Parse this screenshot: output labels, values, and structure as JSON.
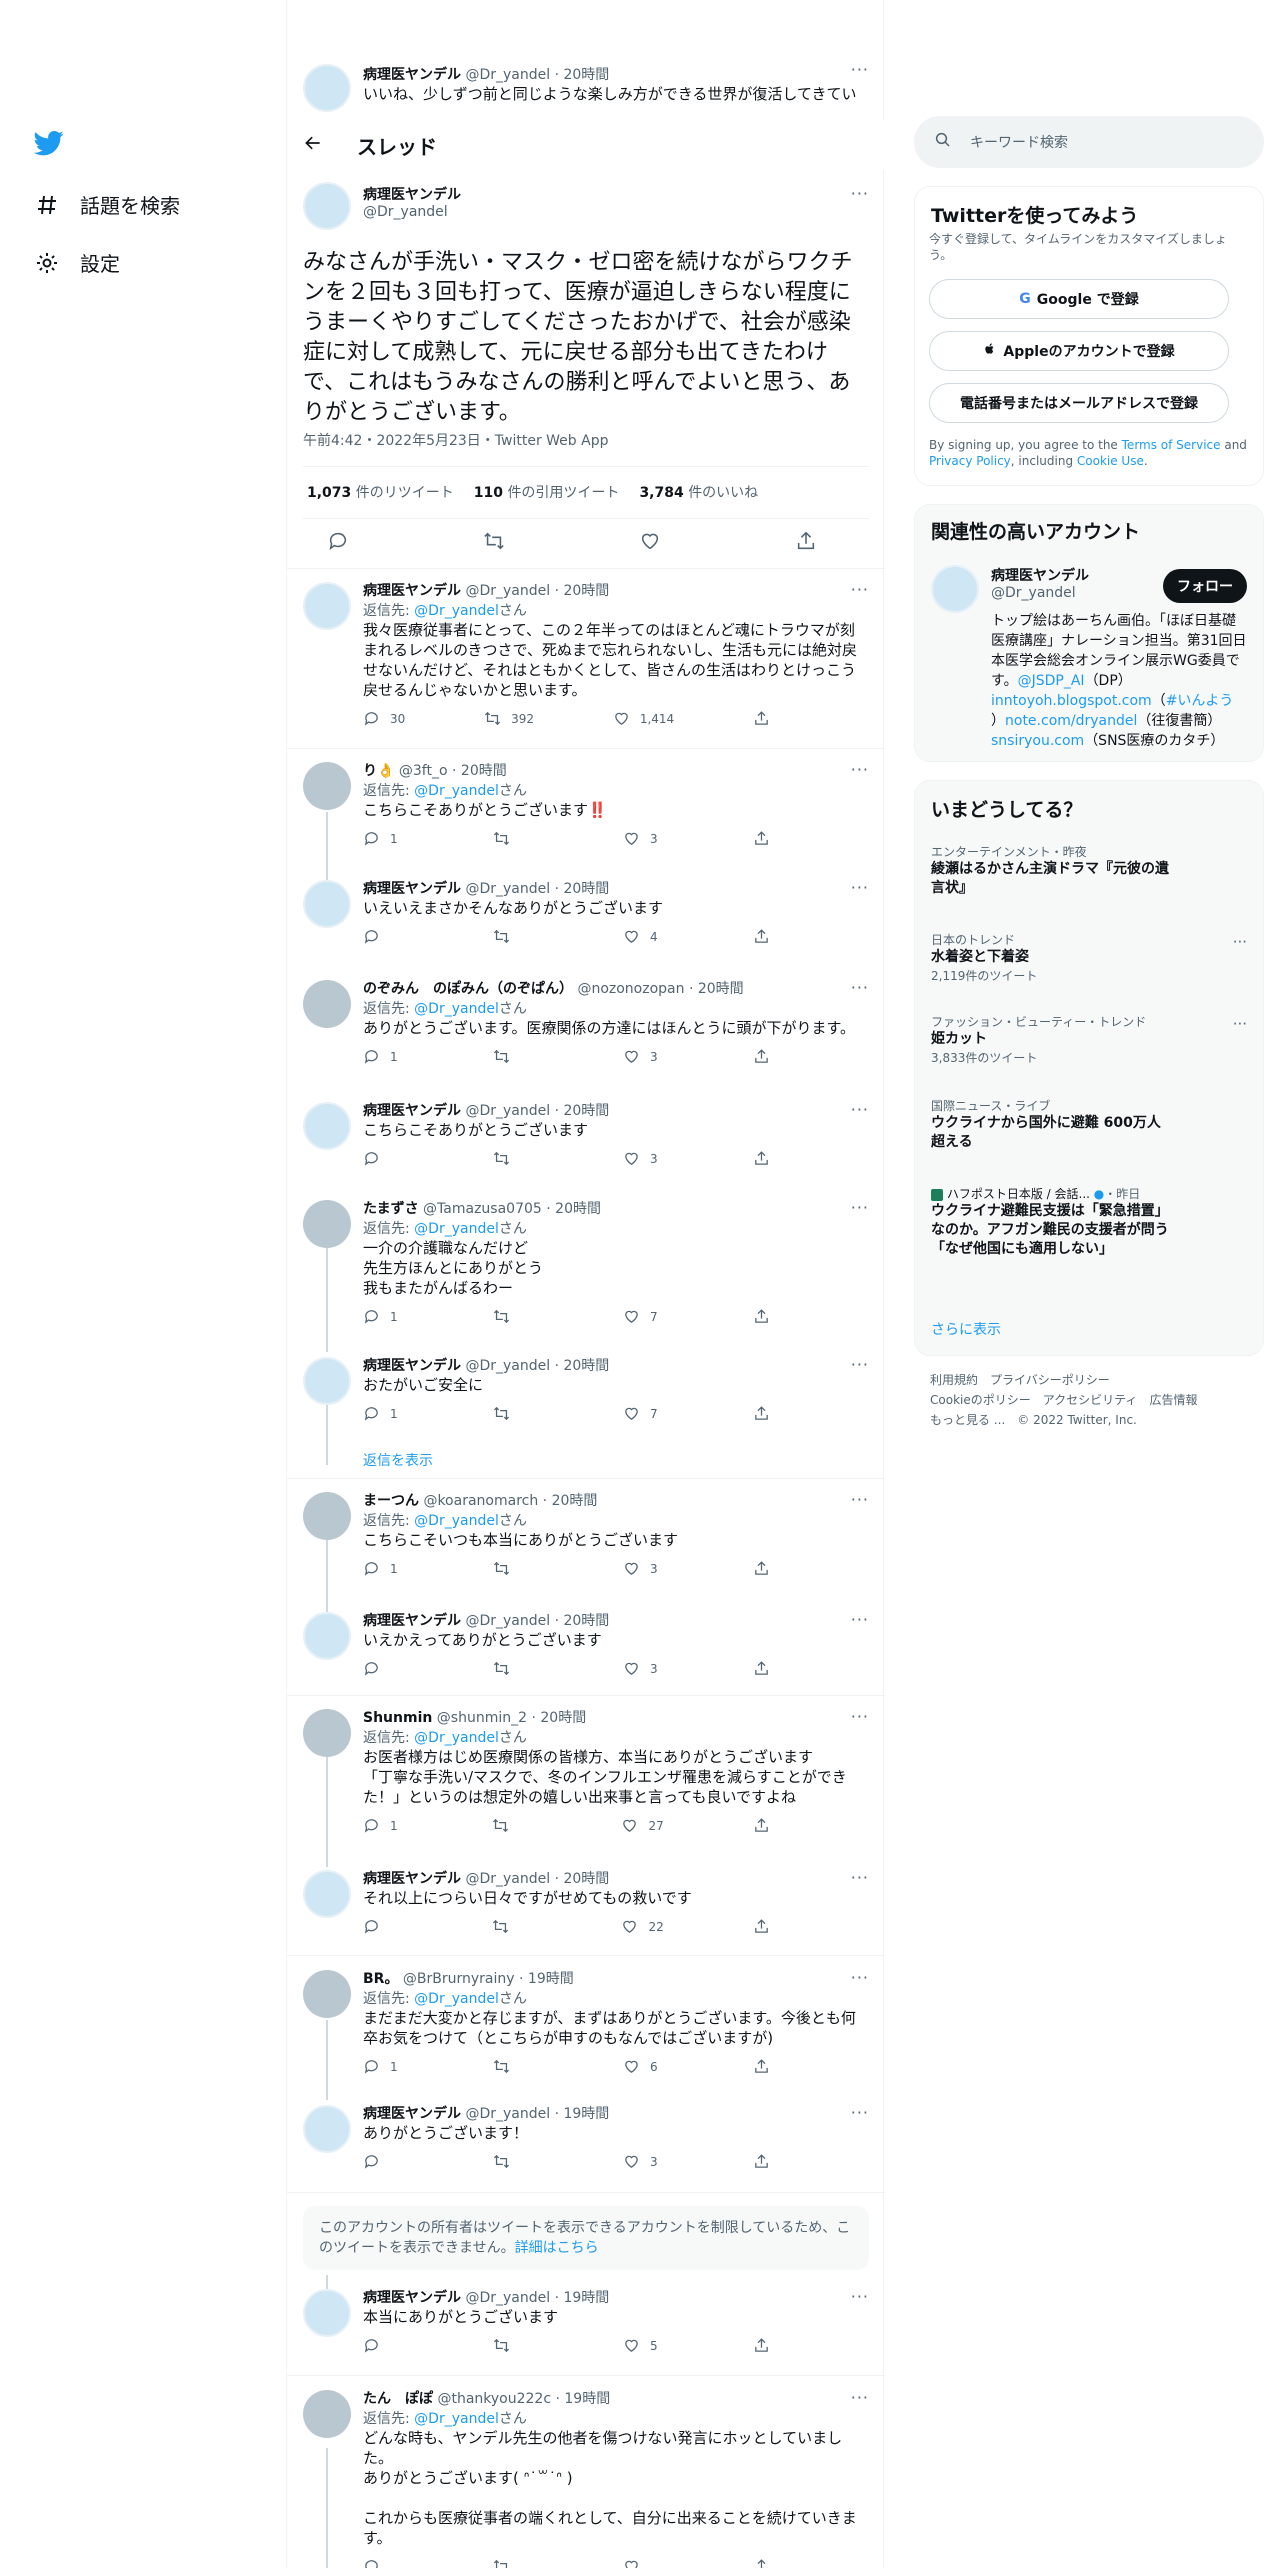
{
  "colors": {
    "brand": "#1d9bf0",
    "text": "#0f1419",
    "muted": "#536471",
    "border": "#eff3f4",
    "like": "#f91880"
  },
  "nav": {
    "logo_icon": "twitter-bird-icon",
    "explore": "話題を検索",
    "settings": "設定"
  },
  "top_tweet": {
    "name": "病理医ヤンデル",
    "handle": "@Dr_yandel",
    "time": "20時間",
    "text": "いいね、少しずつ前と同じような楽しみ方ができる世界が復活してきてい"
  },
  "thread_header": {
    "title": "スレッド"
  },
  "main": {
    "name": "病理医ヤンデル",
    "handle": "@Dr_yandel",
    "text": "みなさんが手洗い・マスク・ゼロ密を続けながらワクチンを２回も３回も打って、医療が逼迫しきらない程度にうまーくやりすごしてくださったおかげで、社会が感染症に対して成熟して、元に戻せる部分も出てきたわけで、これはもうみなさんの勝利と呼んでよいと思う、ありがとうございます。",
    "meta": "午前4:42・2022年5月23日・Twitter Web App",
    "retweets_n": "1,073",
    "retweets_l": "件のリツイート",
    "quotes_n": "110",
    "quotes_l": "件の引用ツイート",
    "likes_n": "3,784",
    "likes_l": "件のいいね"
  },
  "reply_prefix": "返信先: ",
  "reply_suffix": "さん",
  "replies": [
    {
      "name": "病理医ヤンデル",
      "handle": "@Dr_yandel",
      "time": "20時間",
      "reply_to": "@Dr_yandel",
      "text": "我々医療従事者にとって、この２年半ってのはほとんど魂にトラウマが刻まれるレベルのきつさで、死ぬまで忘れられないし、生活も元には絶対戻せないんだけど、それはともかくとして、皆さんの生活はわりとけっこう戻せるんじゃないかと思います。",
      "reply_count": "30",
      "rt": "392",
      "like": "1,414"
    },
    {
      "name": "り👌",
      "handle": "@3ft_o",
      "time": "20時間",
      "reply_to": "@Dr_yandel",
      "text": "こちらこそありがとうございます‼️",
      "reply_count": "1",
      "rt": "",
      "like": "3"
    },
    {
      "name": "病理医ヤンデル",
      "handle": "@Dr_yandel",
      "time": "20時間",
      "reply_to": "",
      "text": "いえいえまさかそんなありがとうございます",
      "reply_count": "",
      "rt": "",
      "like": "4"
    },
    {
      "name": "のぞみん　のぽみん（のぞぱん）",
      "handle": "@nozonozopan",
      "time": "20時間",
      "reply_to": "@Dr_yandel",
      "text": "ありがとうございます。医療関係の方達にはほんとうに頭が下がります。",
      "reply_count": "1",
      "rt": "",
      "like": "3"
    },
    {
      "name": "病理医ヤンデル",
      "handle": "@Dr_yandel",
      "time": "20時間",
      "reply_to": "",
      "text": "こちらこそありがとうございます",
      "reply_count": "",
      "rt": "",
      "like": "3"
    },
    {
      "name": "たまずさ",
      "handle": "@Tamazusa0705",
      "time": "20時間",
      "reply_to": "@Dr_yandel",
      "text": "一介の介護職なんだけど\n先生方ほんとにありがとう\n我もまたがんばるわー",
      "reply_count": "1",
      "rt": "",
      "like": "7"
    },
    {
      "name": "病理医ヤンデル",
      "handle": "@Dr_yandel",
      "time": "20時間",
      "reply_to": "",
      "text": "おたがいご安全に",
      "reply_count": "1",
      "rt": "",
      "like": "7"
    },
    {
      "name": "まーつん",
      "handle": "@koaranomarch",
      "time": "20時間",
      "reply_to": "@Dr_yandel",
      "text": "こちらこそいつも本当にありがとうございます",
      "reply_count": "1",
      "rt": "",
      "like": "3"
    },
    {
      "name": "病理医ヤンデル",
      "handle": "@Dr_yandel",
      "time": "20時間",
      "reply_to": "",
      "text": "いえかえってありがとうございます",
      "reply_count": "",
      "rt": "",
      "like": "3"
    },
    {
      "name": "Shunmin",
      "handle": "@shunmin_2",
      "time": "20時間",
      "reply_to": "@Dr_yandel",
      "text": "お医者様方はじめ医療関係の皆様方、本当にありがとうございます\n「丁寧な手洗い/マスクで、冬のインフルエンザ罹患を減らすことができた！」というのは想定外の嬉しい出来事と言っても良いですよね",
      "reply_count": "1",
      "rt": "",
      "like": "27"
    },
    {
      "name": "病理医ヤンデル",
      "handle": "@Dr_yandel",
      "time": "20時間",
      "reply_to": "",
      "text": "それ以上につらい日々ですがせめてもの救いです",
      "reply_count": "",
      "rt": "",
      "like": "22"
    },
    {
      "name": "BR。",
      "handle": "@BrBrurnyrainy",
      "time": "19時間",
      "reply_to": "@Dr_yandel",
      "text": "まだまだ大変かと存じますが、まずはありがとうございます。今後とも何卒お気をつけて（とこちらが申すのもなんではございますが)",
      "reply_count": "1",
      "rt": "",
      "like": "6"
    },
    {
      "name": "病理医ヤンデル",
      "handle": "@Dr_yandel",
      "time": "19時間",
      "reply_to": "",
      "text": "ありがとうございます！",
      "reply_count": "",
      "rt": "",
      "like": "3"
    },
    {
      "name": "病理医ヤンデル",
      "handle": "@Dr_yandel",
      "time": "19時間",
      "reply_to": "",
      "text": "本当にありがとうございます",
      "reply_count": "",
      "rt": "",
      "like": "5"
    },
    {
      "name": "たん　ぽぽ",
      "handle": "@thankyou222c",
      "time": "19時間",
      "reply_to": "@Dr_yandel",
      "text": "どんな時も、ヤンデル先生の他者を傷つけない発言にホッとしていました。\nありがとうございます( ᐢ˙꒳˙ᐢ )\n\nこれからも医療従事者の端くれとして、自分に出来ることを続けていきます。",
      "reply_count": "",
      "rt": "",
      "like": ""
    }
  ],
  "show_replies": "返信を表示",
  "restricted": {
    "text": "このアカウントの所有者はツイートを表示できるアカウントを制限しているため、このツイートを表示できません。",
    "link": "詳細はこちら"
  },
  "search": {
    "placeholder": "キーワード検索"
  },
  "signup": {
    "title": "Twitterを使ってみよう",
    "sub": "今すぐ登録して、タイムラインをカスタマイズしましょう。",
    "google": "Google で登録",
    "apple": "Appleのアカウントで登録",
    "phone": "電話番号またはメールアドレスで登録",
    "legal_a": "By signing up, you agree to the ",
    "tos": "Terms of Service",
    "legal_b": " and ",
    "privacy": "Privacy Policy",
    "legal_c": ", including ",
    "cookie": "Cookie Use",
    "legal_d": "."
  },
  "related": {
    "title": "関連性の高いアカウント",
    "name": "病理医ヤンデル",
    "handle": "@Dr_yandel",
    "follow": "フォロー",
    "bio_a": "トップ絵はあーちん画伯。「ほぼ日基礎医療講座」ナレーション担当。第31回日本医学会総会オンライン展示WG委員です。",
    "bio_l1": "@JSDP_AI",
    "bio_b": "（DP）",
    "bio_l2": "inntoyoh.blogspot.com",
    "bio_c": "（",
    "bio_l3": "#いんよう",
    "bio_d": "）",
    "bio_l4": "note.com/dryandel",
    "bio_e": "（往復書簡）",
    "bio_l5": "snsiryou.com",
    "bio_f": "（SNS医療のカタチ）"
  },
  "trends": {
    "title": "いまどうしてる？",
    "items": [
      {
        "ctx": "エンターテインメント・昨夜",
        "title": "綾瀬はるかさん主演ドラマ『元彼の遺言状』",
        "count": ""
      },
      {
        "ctx": "日本のトレンド",
        "title": "水着姿と下着姿",
        "count": "2,119件のツイート"
      },
      {
        "ctx": "ファッション・ビューティー・トレンド",
        "title": "姫カット",
        "count": "3,833件のツイート"
      },
      {
        "ctx": "国際ニュース・ライブ",
        "title": "ウクライナから国外に避難 600万人超える",
        "count": ""
      },
      {
        "ctx": "ハフポスト日本版 / 会話...",
        "ctx2": "・昨日",
        "title": "ウクライナ避難民支援は「緊急措置」なのか。アフガン難民の支援者が問う「なぜ他国にも適用しない」",
        "count": ""
      }
    ],
    "more": "さらに表示"
  },
  "footer": {
    "l1": "利用規約",
    "l2": "プライバシーポリシー",
    "l3": "Cookieのポリシー",
    "l4": "アクセシビリティ",
    "l5": "広告情報",
    "l6": "もっと見る ...",
    "l7": "© 2022 Twitter, Inc."
  }
}
